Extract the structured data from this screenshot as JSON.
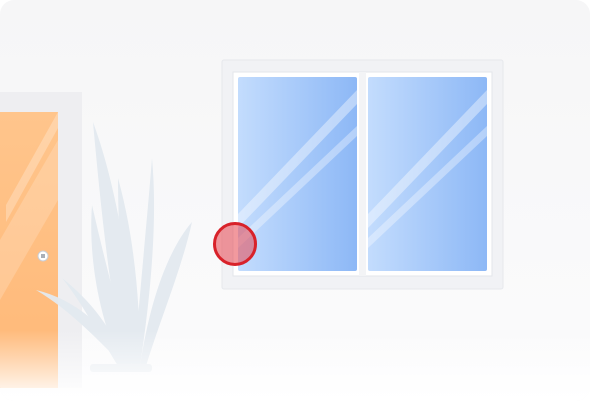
{
  "scene": {
    "background_color": "#f7f7f8",
    "objects": [
      "door",
      "door-knob",
      "plant",
      "window",
      "window-pane-left",
      "window-pane-right",
      "hotspot-marker"
    ]
  },
  "colors": {
    "door": "#ffc48a",
    "door_frame": "#ececef",
    "glass": "#9cc4fb",
    "window_frame": "#f2f3f5",
    "plant": "#e4ebf1",
    "hotspot_border": "#d8222a",
    "hotspot_fill": "#e8464e"
  },
  "hotspot": {
    "label": ""
  }
}
